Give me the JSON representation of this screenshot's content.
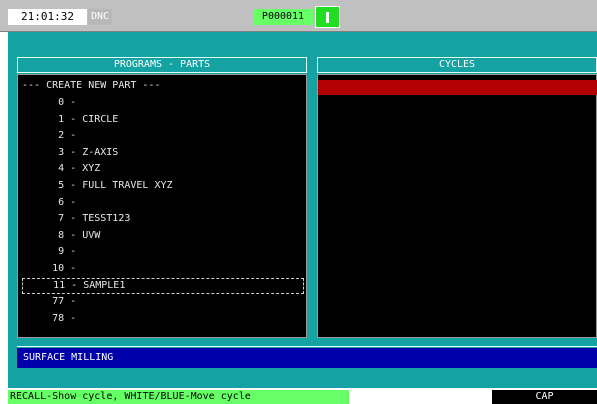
{
  "topbar": {
    "time": "21:01:32",
    "dnc_label": "DNC",
    "program_id": "P000011"
  },
  "programs_panel": {
    "title": "PROGRAMS - PARTS",
    "create_label": "--- CREATE NEW PART ---",
    "items": [
      {
        "number": "0",
        "name": ""
      },
      {
        "number": "1",
        "name": "CIRCLE"
      },
      {
        "number": "2",
        "name": ""
      },
      {
        "number": "3",
        "name": "Z-AXIS"
      },
      {
        "number": "4",
        "name": "XYZ"
      },
      {
        "number": "5",
        "name": "FULL TRAVEL XYZ"
      },
      {
        "number": "6",
        "name": ""
      },
      {
        "number": "7",
        "name": "TESST123"
      },
      {
        "number": "8",
        "name": "UVW"
      },
      {
        "number": "9",
        "name": ""
      },
      {
        "number": "10",
        "name": ""
      },
      {
        "number": "11",
        "name": "SAMPLE1",
        "selected": true
      },
      {
        "number": "77",
        "name": ""
      },
      {
        "number": "78",
        "name": ""
      }
    ]
  },
  "cycles_panel": {
    "title": "CYCLES"
  },
  "mode_strip": {
    "label": "SURFACE MILLING"
  },
  "statusbar": {
    "hint": "RECALL-Show cycle, WHITE/BLUE-Move cycle",
    "cap": "CAP"
  },
  "colors": {
    "background": "#14a2a2",
    "panel_bg": "#000000",
    "selection_red": "#b30000",
    "strip_blue": "#0000aa",
    "hint_green": "#66ff66"
  }
}
